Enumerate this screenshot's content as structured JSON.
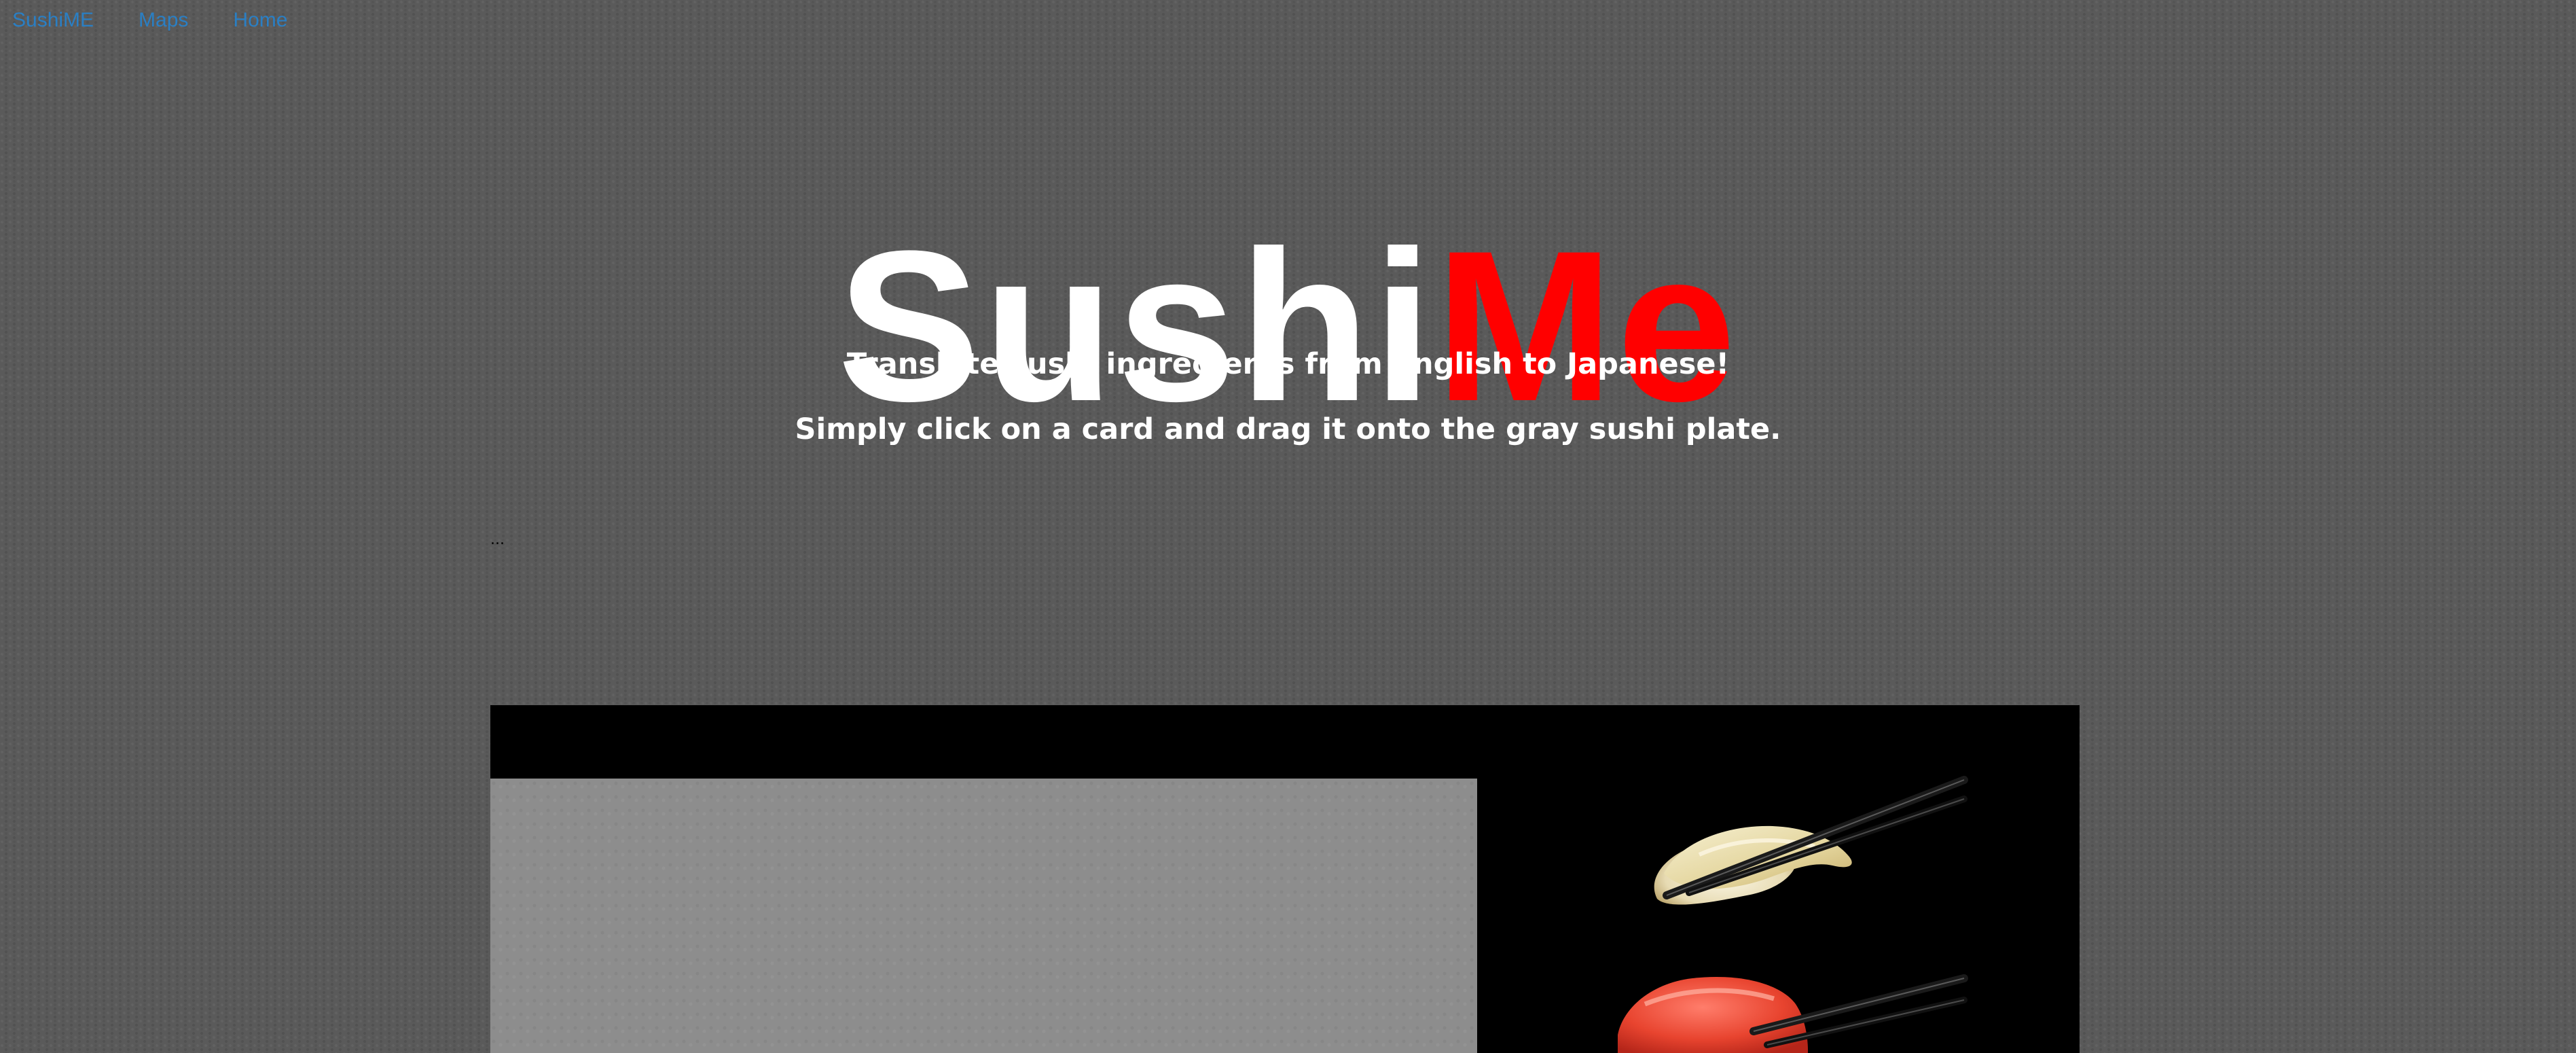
{
  "nav": {
    "links": [
      {
        "label": "SushiME"
      },
      {
        "label": "Maps"
      },
      {
        "label": "Home"
      }
    ]
  },
  "logo": {
    "part1": "Sushi",
    "part2": "Me",
    "colors": {
      "part1": "#ffffff",
      "part2": "#ff0000"
    }
  },
  "tagline": {
    "line1": "Translate sushi ingredients from English to Japanese!",
    "line2": "Simply click on a card and drag it onto the gray sushi plate."
  },
  "status_text": "...",
  "game": {
    "plate_label": "sushi-plate",
    "image_label": "sushi-chopsticks-image"
  },
  "colors": {
    "background": "#5a5a5a",
    "link": "#2a7fc4",
    "plate": "#8d8d8d",
    "game_background": "#000000"
  }
}
